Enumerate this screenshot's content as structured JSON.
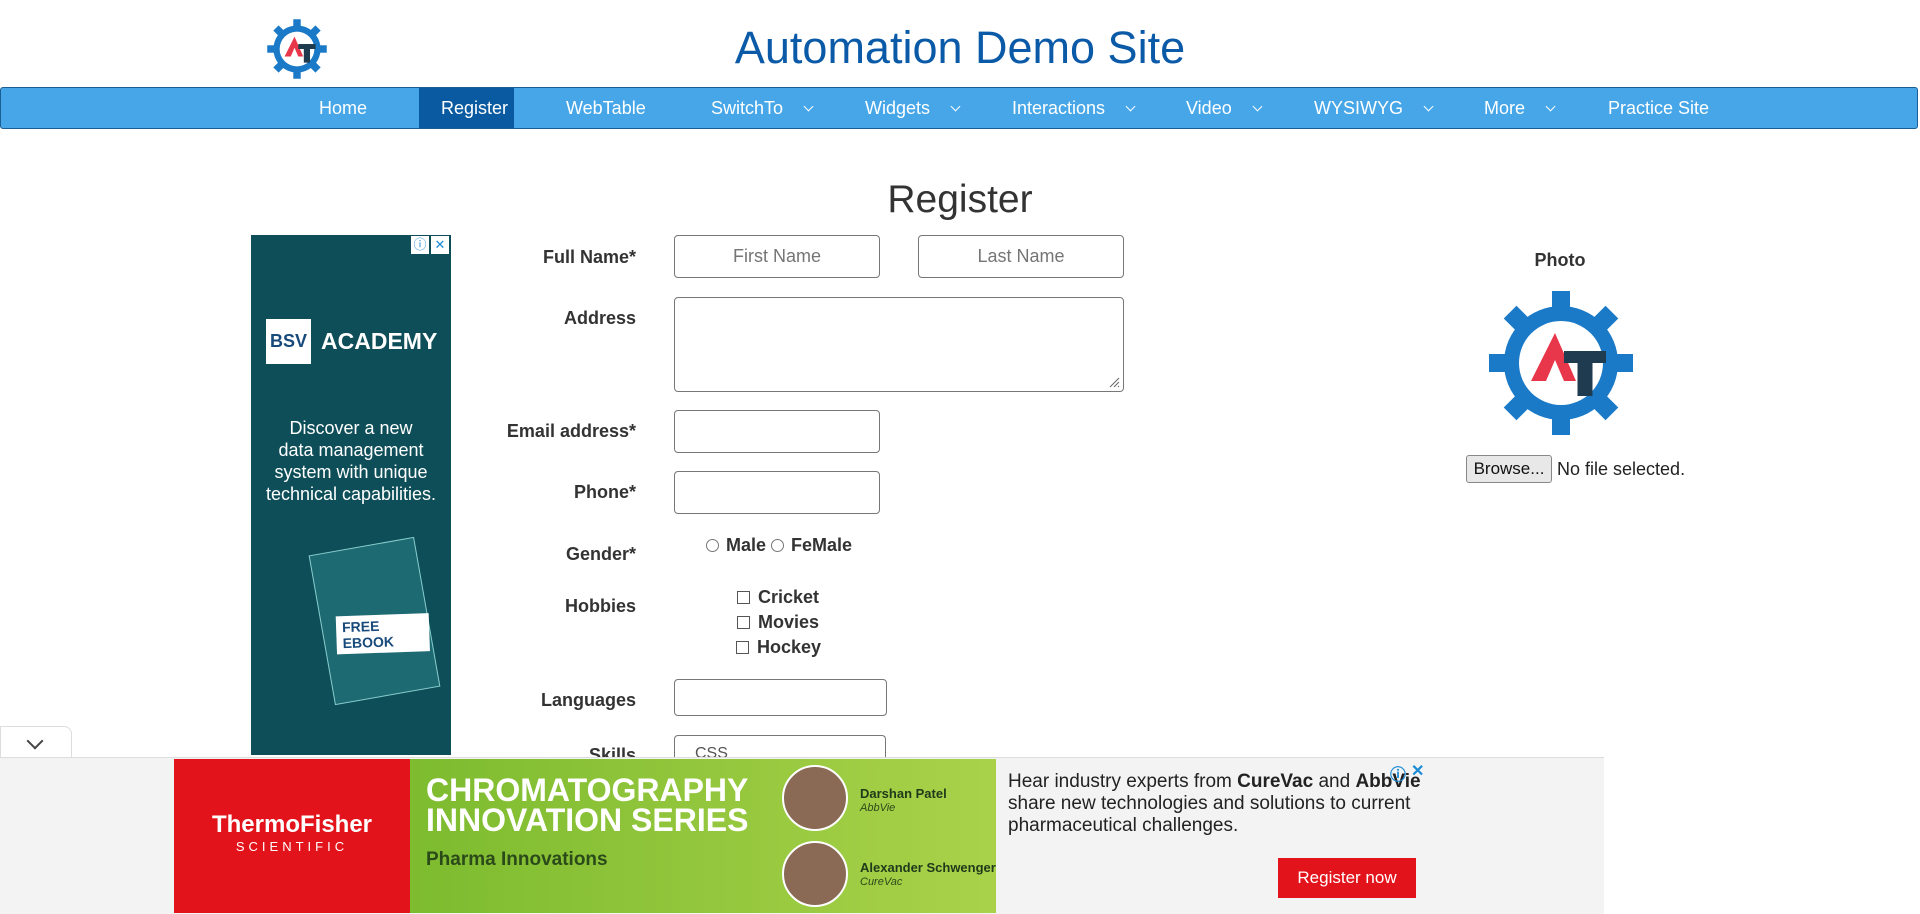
{
  "site": {
    "title": "Automation Demo Site"
  },
  "nav": [
    {
      "label": "Home"
    },
    {
      "label": "Register"
    },
    {
      "label": "WebTable"
    },
    {
      "label": "SwitchTo"
    },
    {
      "label": "Widgets"
    },
    {
      "label": "Interactions"
    },
    {
      "label": "Video"
    },
    {
      "label": "WYSIWYG"
    },
    {
      "label": "More"
    },
    {
      "label": "Practice Site"
    }
  ],
  "form": {
    "heading": "Register",
    "full_name_label": "Full Name*",
    "first_name_placeholder": "First Name",
    "last_name_placeholder": "Last Name",
    "address_label": "Address",
    "email_label": "Email address*",
    "phone_label": "Phone*",
    "gender_label": "Gender*",
    "gender_options": [
      "Male",
      "FeMale"
    ],
    "hobbies_label": "Hobbies",
    "hobbies": [
      "Cricket",
      "Movies",
      "Hockey"
    ],
    "languages_label": "Languages",
    "skills_label": "Skills",
    "skills_value": "CSS"
  },
  "photo": {
    "label": "Photo",
    "browse_label": "Browse...",
    "file_status": "No file selected."
  },
  "left_ad": {
    "brand": "BSV",
    "academy": "ACADEMY",
    "line1": "Discover a new",
    "line2": "data management",
    "line3": "system with unique",
    "line4": "technical capabilities.",
    "ebook": "FREE EBOOK",
    "info": "ⓘ",
    "close": "✕"
  },
  "bottom_ad": {
    "brand": "ThermoFisher",
    "brand_sub": "SCIENTIFIC",
    "headline1": "CHROMATOGRAPHY",
    "headline2": "INNOVATION SERIES",
    "tagline": "Pharma Innovations",
    "speaker1_name": "Darshan Patel",
    "speaker1_org": "AbbVie",
    "speaker2_name": "Alexander Schwenger",
    "speaker2_org": "CureVac",
    "text_pre": "Hear industry experts from ",
    "text_b1": "CureVac",
    "text_mid": " and ",
    "text_b2": "AbbVie",
    "text_post": " share new technologies and solutions to current pharmaceutical challenges.",
    "cta": "Register now",
    "info": "ⓘ",
    "close": "✕"
  },
  "colors": {
    "nav_bg": "#46a6e7",
    "nav_active": "#095aa0",
    "title": "#0a5aa8",
    "logo_blue": "#1a7ac8",
    "logo_red": "#e8364a",
    "logo_dark": "#1f3b50"
  }
}
